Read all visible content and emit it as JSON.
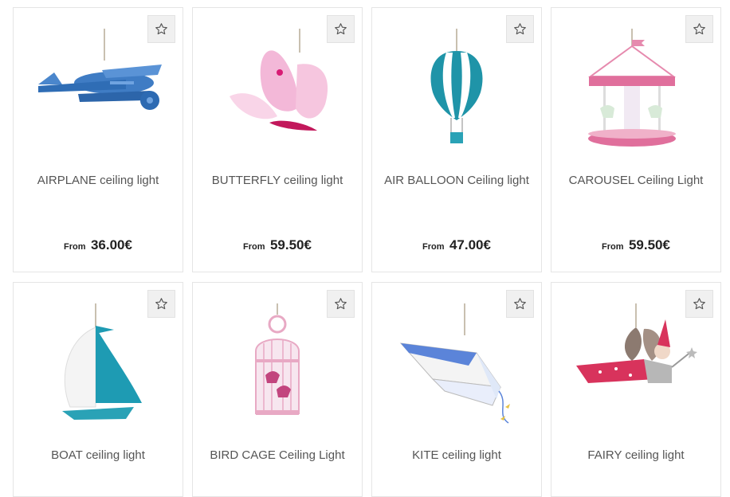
{
  "colors": {
    "border": "#e5e5e5",
    "fav_bg": "#f0f0f0",
    "title": "#555555",
    "price": "#222222"
  },
  "products": [
    {
      "title": "AIRPLANE ceiling light",
      "price_prefix": "From",
      "price": "36.00€",
      "image_icon": "airplane-lamp"
    },
    {
      "title": "BUTTERFLY ceiling light",
      "price_prefix": "From",
      "price": "59.50€",
      "image_icon": "butterfly-lamp"
    },
    {
      "title": "AIR BALLOON Ceiling light",
      "price_prefix": "From",
      "price": "47.00€",
      "image_icon": "air-balloon-lamp"
    },
    {
      "title": "CAROUSEL Ceiling Light",
      "price_prefix": "From",
      "price": "59.50€",
      "image_icon": "carousel-lamp"
    },
    {
      "title": "BOAT ceiling light",
      "image_icon": "boat-lamp"
    },
    {
      "title": "BIRD CAGE Ceiling Light",
      "image_icon": "bird-cage-lamp"
    },
    {
      "title": "KITE ceiling light",
      "image_icon": "kite-lamp"
    },
    {
      "title": "FAIRY ceiling light",
      "image_icon": "fairy-lamp"
    }
  ]
}
